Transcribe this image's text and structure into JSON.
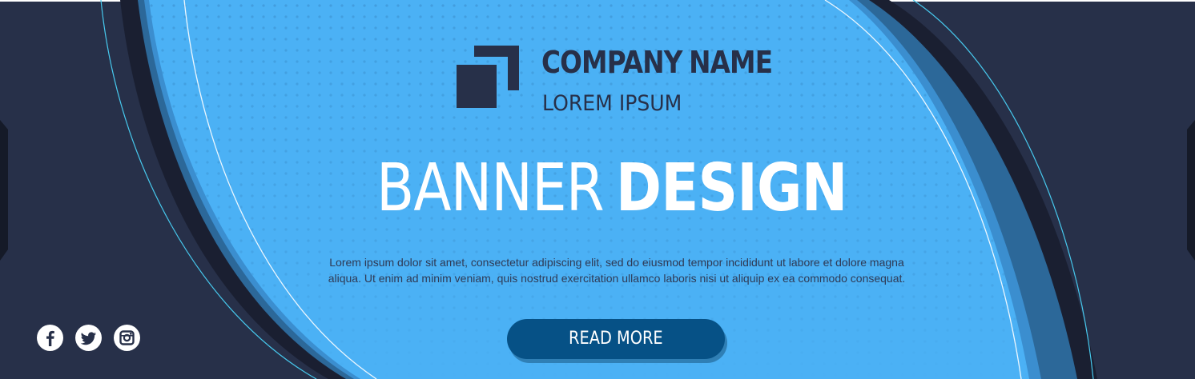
{
  "banner": {
    "logo": {
      "icon": "overlapping-squares-logo"
    },
    "company_name": {
      "regular": "COMPANY",
      "bold": "NAME"
    },
    "tagline": "LOREM IPSUM",
    "headline": {
      "regular": "BANNER",
      "bold": "DESIGN"
    },
    "body_line_1": "Lorem ipsum dolor sit amet, consectetur adipiscing elit, sed do eiusmod tempor incididunt ut labore et dolore magna",
    "body_line_2": "aliqua. Ut enim ad minim veniam, quis nostrud exercitation ullamco laboris nisi ut aliquip ex ea commodo consequat.",
    "cta_label": "READ MORE",
    "social_icons": [
      "facebook-icon",
      "twitter-icon",
      "instagram-icon"
    ]
  },
  "colors": {
    "navy": "#273049",
    "sky_blue": "#4bb1f5",
    "button_blue": "#065186",
    "white": "#ffffff"
  }
}
